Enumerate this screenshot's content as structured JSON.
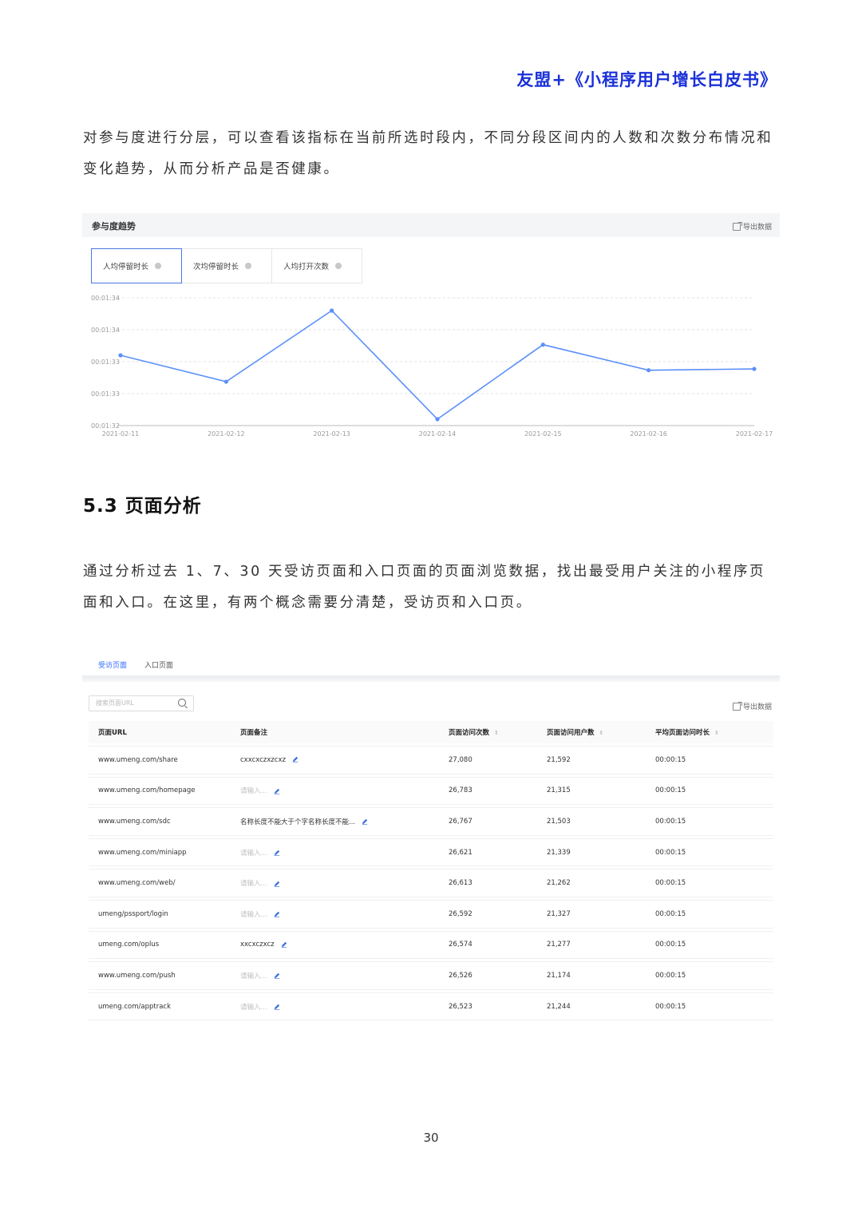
{
  "header": {
    "title": "友盟+《小程序用户增长白皮书》"
  },
  "paragraph1": "对参与度进行分层，可以查看该指标在当前所选时段内，不同分段区间内的人数和次数分布情况和变化趋势，从而分析产品是否健康。",
  "engagement": {
    "title": "参与度趋势",
    "export_label": "导出数据",
    "tabs": [
      {
        "label": "人均停留时长"
      },
      {
        "label": "次均停留时长"
      },
      {
        "label": "人均打开次数"
      }
    ]
  },
  "chart_data": {
    "type": "line",
    "x": [
      "2021-02-11",
      "2021-02-12",
      "2021-02-13",
      "2021-02-14",
      "2021-02-15",
      "2021-02-16",
      "2021-02-17"
    ],
    "y_seconds": [
      93.35,
      92.73,
      94.4,
      91.85,
      93.6,
      93.0,
      93.03
    ],
    "y_tick_labels": [
      "00:01:34",
      "00:01:34",
      "00:01:33",
      "00:01:33",
      "00:01:32"
    ],
    "ylim": [
      91.7,
      94.7
    ],
    "grid": true,
    "color": "#5b8ff9"
  },
  "section": {
    "title": "5.3 页面分析"
  },
  "paragraph2": "通过分析过去 1、7、30 天受访页面和入口页面的页面浏览数据，找出最受用户关注的小程序页面和入口。在这里，有两个概念需要分清楚，受访页和入口页。",
  "pages_panel": {
    "tabs": [
      {
        "label": "受访页面"
      },
      {
        "label": "入口页面"
      }
    ],
    "search_placeholder": "搜索页面URL",
    "export_label": "导出数据",
    "columns": [
      "页面URL",
      "页面备注",
      "页面访问次数",
      "页面访问用户数",
      "平均页面访问时长"
    ],
    "rows": [
      {
        "url": "www.umeng.com/share",
        "note": "cxxcxczxzcxz",
        "note_placeholder": false,
        "visits": "27,080",
        "users": "21,592",
        "duration": "00:00:15"
      },
      {
        "url": "www.umeng.com/homepage",
        "note": "请输入...",
        "note_placeholder": true,
        "visits": "26,783",
        "users": "21,315",
        "duration": "00:00:15"
      },
      {
        "url": "www.umeng.com/sdc",
        "note": "名称长度不能大于个字名称长度不能...",
        "note_placeholder": false,
        "visits": "26,767",
        "users": "21,503",
        "duration": "00:00:15"
      },
      {
        "url": "www.umeng.com/miniapp",
        "note": "请输入...",
        "note_placeholder": true,
        "visits": "26,621",
        "users": "21,339",
        "duration": "00:00:15"
      },
      {
        "url": "www.umeng.com/web/",
        "note": "请输入...",
        "note_placeholder": true,
        "visits": "26,613",
        "users": "21,262",
        "duration": "00:00:15"
      },
      {
        "url": "umeng/pssport/login",
        "note": "请输入...",
        "note_placeholder": true,
        "visits": "26,592",
        "users": "21,327",
        "duration": "00:00:15"
      },
      {
        "url": "umeng.com/oplus",
        "note": "xxcxczxcz",
        "note_placeholder": false,
        "visits": "26,574",
        "users": "21,277",
        "duration": "00:00:15"
      },
      {
        "url": "www.umeng.com/push",
        "note": "请输入...",
        "note_placeholder": true,
        "visits": "26,526",
        "users": "21,174",
        "duration": "00:00:15"
      },
      {
        "url": "umeng.com/apptrack",
        "note": "请输入...",
        "note_placeholder": true,
        "visits": "26,523",
        "users": "21,244",
        "duration": "00:00:15"
      }
    ]
  },
  "footer": {
    "page_number": "30"
  }
}
